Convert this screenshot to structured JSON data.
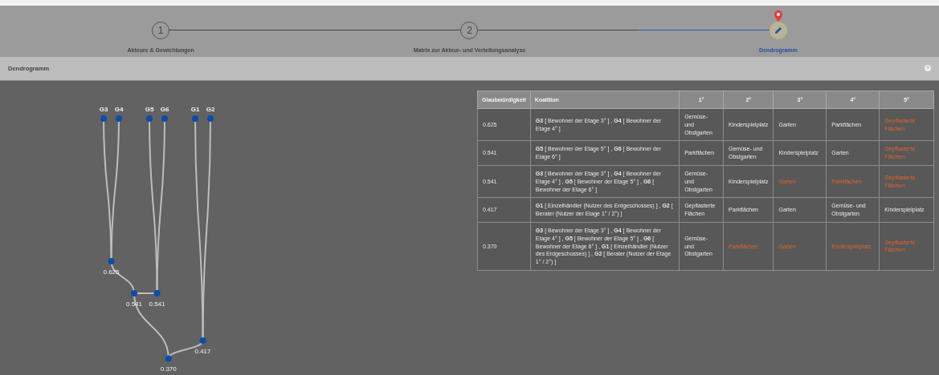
{
  "steps": [
    {
      "number": "1",
      "label": "Akteure & Gewichtungen",
      "selected": false
    },
    {
      "number": "2",
      "label": "Matrix zur Akteur- und Verteilungsanalyse",
      "selected": false
    },
    {
      "label": "Dendrogramm",
      "selected": true
    }
  ],
  "panel": {
    "title": "Dendrogramm"
  },
  "dendrogram": {
    "value": "0.370",
    "children": [
      {
        "value": "0.541",
        "children": [
          {
            "value": "0.625",
            "children": [
              {
                "label": "G3"
              },
              {
                "label": "G4"
              }
            ]
          },
          {
            "value": "0.541",
            "children": [
              {
                "label": "G5"
              },
              {
                "label": "G6"
              }
            ]
          }
        ]
      },
      {
        "value": "0.417",
        "children": [
          {
            "label": "G1"
          },
          {
            "label": "G2"
          }
        ]
      }
    ]
  },
  "table": {
    "columns": [
      "Glaubwürdigkeit",
      "Koalition",
      "1°",
      "2°",
      "3°",
      "4°",
      "5°"
    ],
    "rows": [
      {
        "credibility": "0.625",
        "coalition": "**G3** [ Bewohner der Etage 3° ] ,  **G4** [ Bewohner der Etage 4° ]",
        "ranks": [
          {
            "text": "Gemüse- und Obstgarten",
            "highlighted": false
          },
          {
            "text": "Kinderspielplatz",
            "highlighted": false
          },
          {
            "text": "Garten",
            "highlighted": false
          },
          {
            "text": "Parkflächen",
            "highlighted": false
          },
          {
            "text": "Gepflasterte Flächen",
            "highlighted": true
          }
        ]
      },
      {
        "credibility": "0.541",
        "coalition": "**G5** [ Bewohner der Etage 5° ] ,  **G6** [ Bewohner der Etage 6° ]",
        "ranks": [
          {
            "text": "Parkflächen",
            "highlighted": false
          },
          {
            "text": "Gemüse- und Obstgarten",
            "highlighted": false
          },
          {
            "text": "Kinderspielplatz",
            "highlighted": false
          },
          {
            "text": "Garten",
            "highlighted": false
          },
          {
            "text": "Gepflasterte Flächen",
            "highlighted": true
          }
        ]
      },
      {
        "credibility": "0.541",
        "coalition": "**G3** [ Bewohner der Etage 3° ] ,  **G4** [ Bewohner der Etage 4° ] ,  **G5** [ Bewohner der Etage 5° ] ,  **G6** [ Bewohner der Etage 6° ]",
        "ranks": [
          {
            "text": "Gemüse- und Obstgarten",
            "highlighted": false
          },
          {
            "text": "Kinderspielplatz",
            "highlighted": false
          },
          {
            "text": "Garten",
            "highlighted": true
          },
          {
            "text": "Parkflächen",
            "highlighted": true
          },
          {
            "text": "Gepflasterte Flächen",
            "highlighted": true
          }
        ]
      },
      {
        "credibility": "0.417",
        "coalition": "**G1** [ Einzelhändler (Nutzer des Erdgeschosses) ] ,  **G2** [ Berater (Nutzer der Etage 1° / 2°) ]",
        "ranks": [
          {
            "text": "Gepflasterte Flächen",
            "highlighted": false
          },
          {
            "text": "Parkflächen",
            "highlighted": false
          },
          {
            "text": "Garten",
            "highlighted": false
          },
          {
            "text": "Gemüse- und Obstgarten",
            "highlighted": false
          },
          {
            "text": "Kinderspielplatz",
            "highlighted": false
          }
        ]
      },
      {
        "credibility": "0.370",
        "coalition": "**G3** [ Bewohner der Etage 3° ] ,  **G4** [ Bewohner der Etage 4° ] ,  **G5** [ Bewohner der Etage 5° ] ,  **G6** [ Bewohner der Etage 6° ] ,  **G1** [ Einzelhändler (Nutzer des Erdgeschosses) ] ,  **G2** [ Berater (Nutzer der Etage 1° / 2°) ]",
        "ranks": [
          {
            "text": "Gemüse- und Obstgarten",
            "highlighted": false
          },
          {
            "text": "Parkflächen",
            "highlighted": true
          },
          {
            "text": "Garten",
            "highlighted": true
          },
          {
            "text": "Kinderspielplatz",
            "highlighted": true
          },
          {
            "text": "Gepflasterte Flächen",
            "highlighted": true
          }
        ]
      }
    ]
  }
}
